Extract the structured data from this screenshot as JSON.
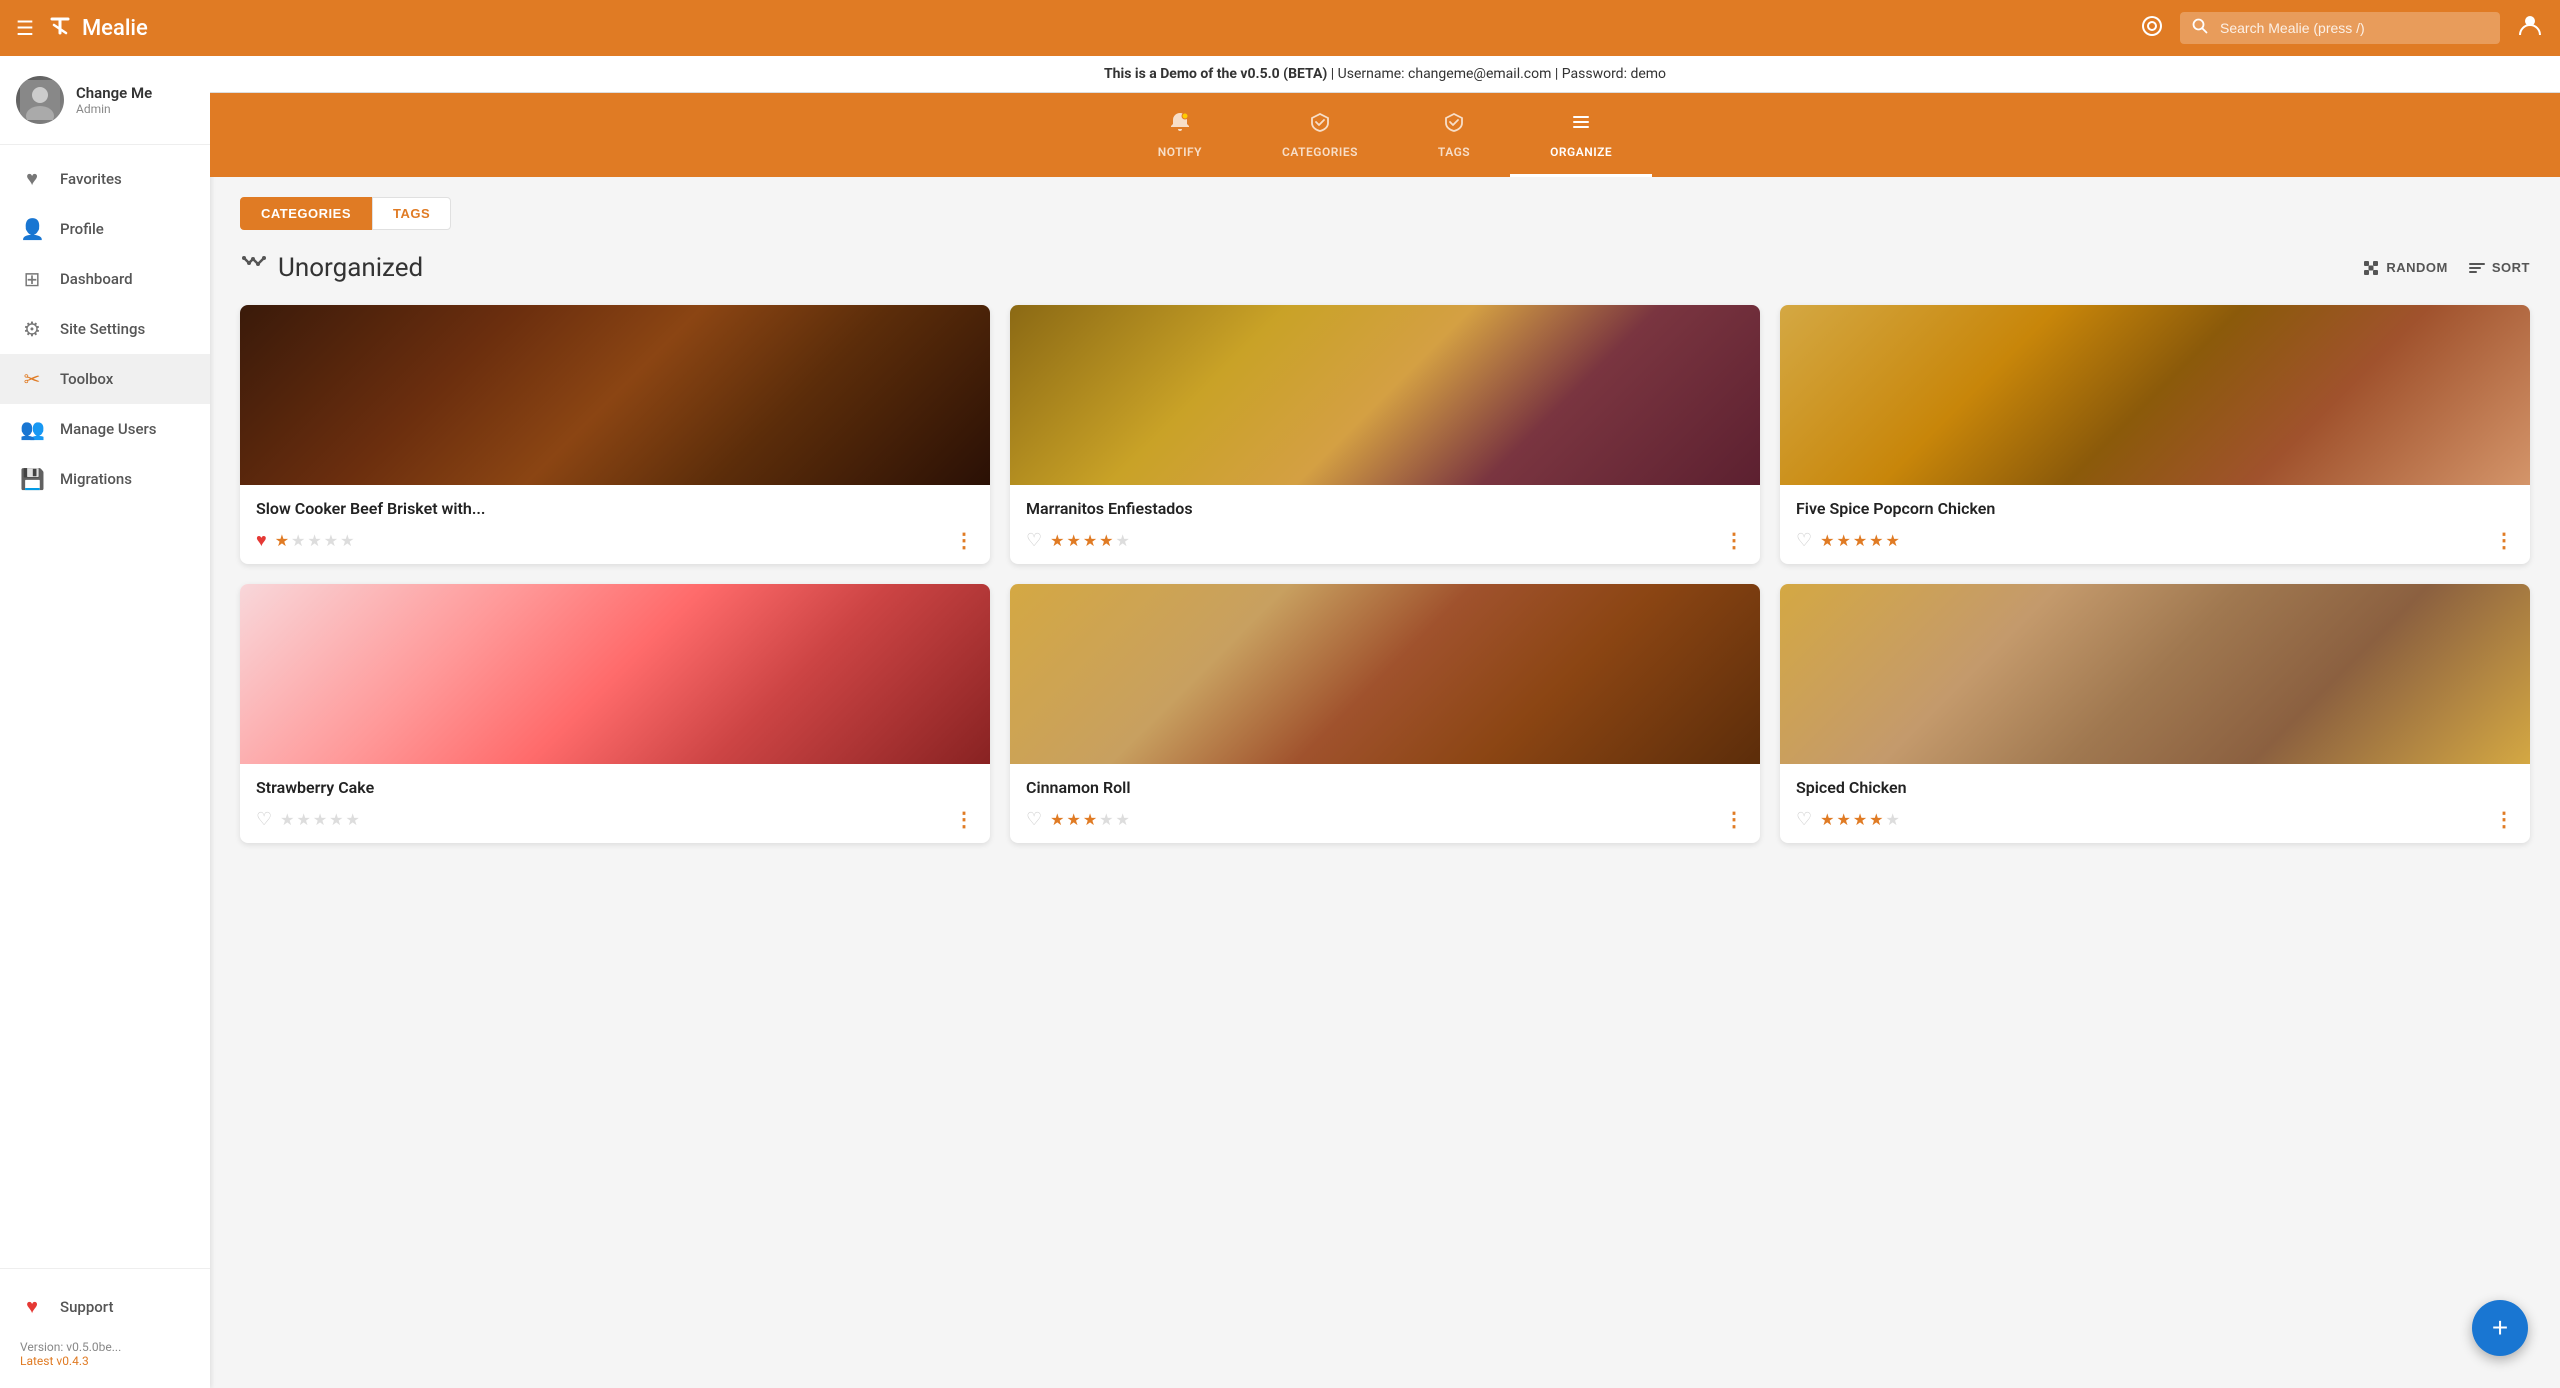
{
  "topbar": {
    "menu_label": "☰",
    "logo_icon": "✕",
    "logo_text": "Mealie",
    "search_placeholder": "Search Mealie (press /)",
    "settings_icon": "⚙",
    "user_icon": "👤"
  },
  "demo_banner": {
    "bold_text": "This is a Demo of the v0.5.0 (BETA)",
    "rest_text": " | Username: changeme@email.com | Password: demo"
  },
  "sidebar": {
    "username": "Change Me",
    "role": "Admin",
    "nav_items": [
      {
        "id": "favorites",
        "label": "Favorites",
        "icon": "♥"
      },
      {
        "id": "profile",
        "label": "Profile",
        "icon": "👤"
      },
      {
        "id": "dashboard",
        "label": "Dashboard",
        "icon": "⊞"
      },
      {
        "id": "site-settings",
        "label": "Site Settings",
        "icon": "⚙"
      },
      {
        "id": "toolbox",
        "label": "Toolbox",
        "icon": "✂",
        "active": true
      },
      {
        "id": "manage-users",
        "label": "Manage Users",
        "icon": "👥"
      },
      {
        "id": "migrations",
        "label": "Migrations",
        "icon": "💾"
      }
    ],
    "support_label": "Support",
    "support_icon": "♥",
    "version_label": "Version: v0.5.0be...",
    "version_link_label": "Latest v0.4.3"
  },
  "sub_nav": {
    "items": [
      {
        "id": "notify",
        "label": "NOTIFY",
        "icon": "🔔"
      },
      {
        "id": "categories",
        "label": "CATEGORIES",
        "icon": "🏷"
      },
      {
        "id": "tags",
        "label": "TAGS",
        "icon": "🏷"
      },
      {
        "id": "organize",
        "label": "ORGANIZE",
        "icon": "✎",
        "active": true
      }
    ]
  },
  "page": {
    "tabs": [
      {
        "id": "categories",
        "label": "CATEGORIES",
        "active": true
      },
      {
        "id": "tags",
        "label": "TAGS"
      }
    ],
    "section_title": "Unorganized",
    "random_label": "RANDOM",
    "sort_label": "SORT",
    "recipes": [
      {
        "id": 1,
        "title": "Slow Cooker Beef Brisket with...",
        "img_class": "food-img-1",
        "favorited": true,
        "rating": 1,
        "max_rating": 5
      },
      {
        "id": 2,
        "title": "Marranitos Enfiestados",
        "img_class": "food-img-2",
        "favorited": false,
        "rating": 4,
        "max_rating": 5
      },
      {
        "id": 3,
        "title": "Five Spice Popcorn Chicken",
        "img_class": "food-img-3",
        "favorited": false,
        "rating": 5,
        "max_rating": 5
      },
      {
        "id": 4,
        "title": "Strawberry Cake",
        "img_class": "food-img-4",
        "favorited": false,
        "rating": 0,
        "max_rating": 5
      },
      {
        "id": 5,
        "title": "Cinnamon Roll",
        "img_class": "food-img-5",
        "favorited": false,
        "rating": 3,
        "max_rating": 5
      },
      {
        "id": 6,
        "title": "Spiced Chicken",
        "img_class": "food-img-6",
        "favorited": false,
        "rating": 4,
        "max_rating": 5
      }
    ],
    "fab_icon": "+"
  }
}
